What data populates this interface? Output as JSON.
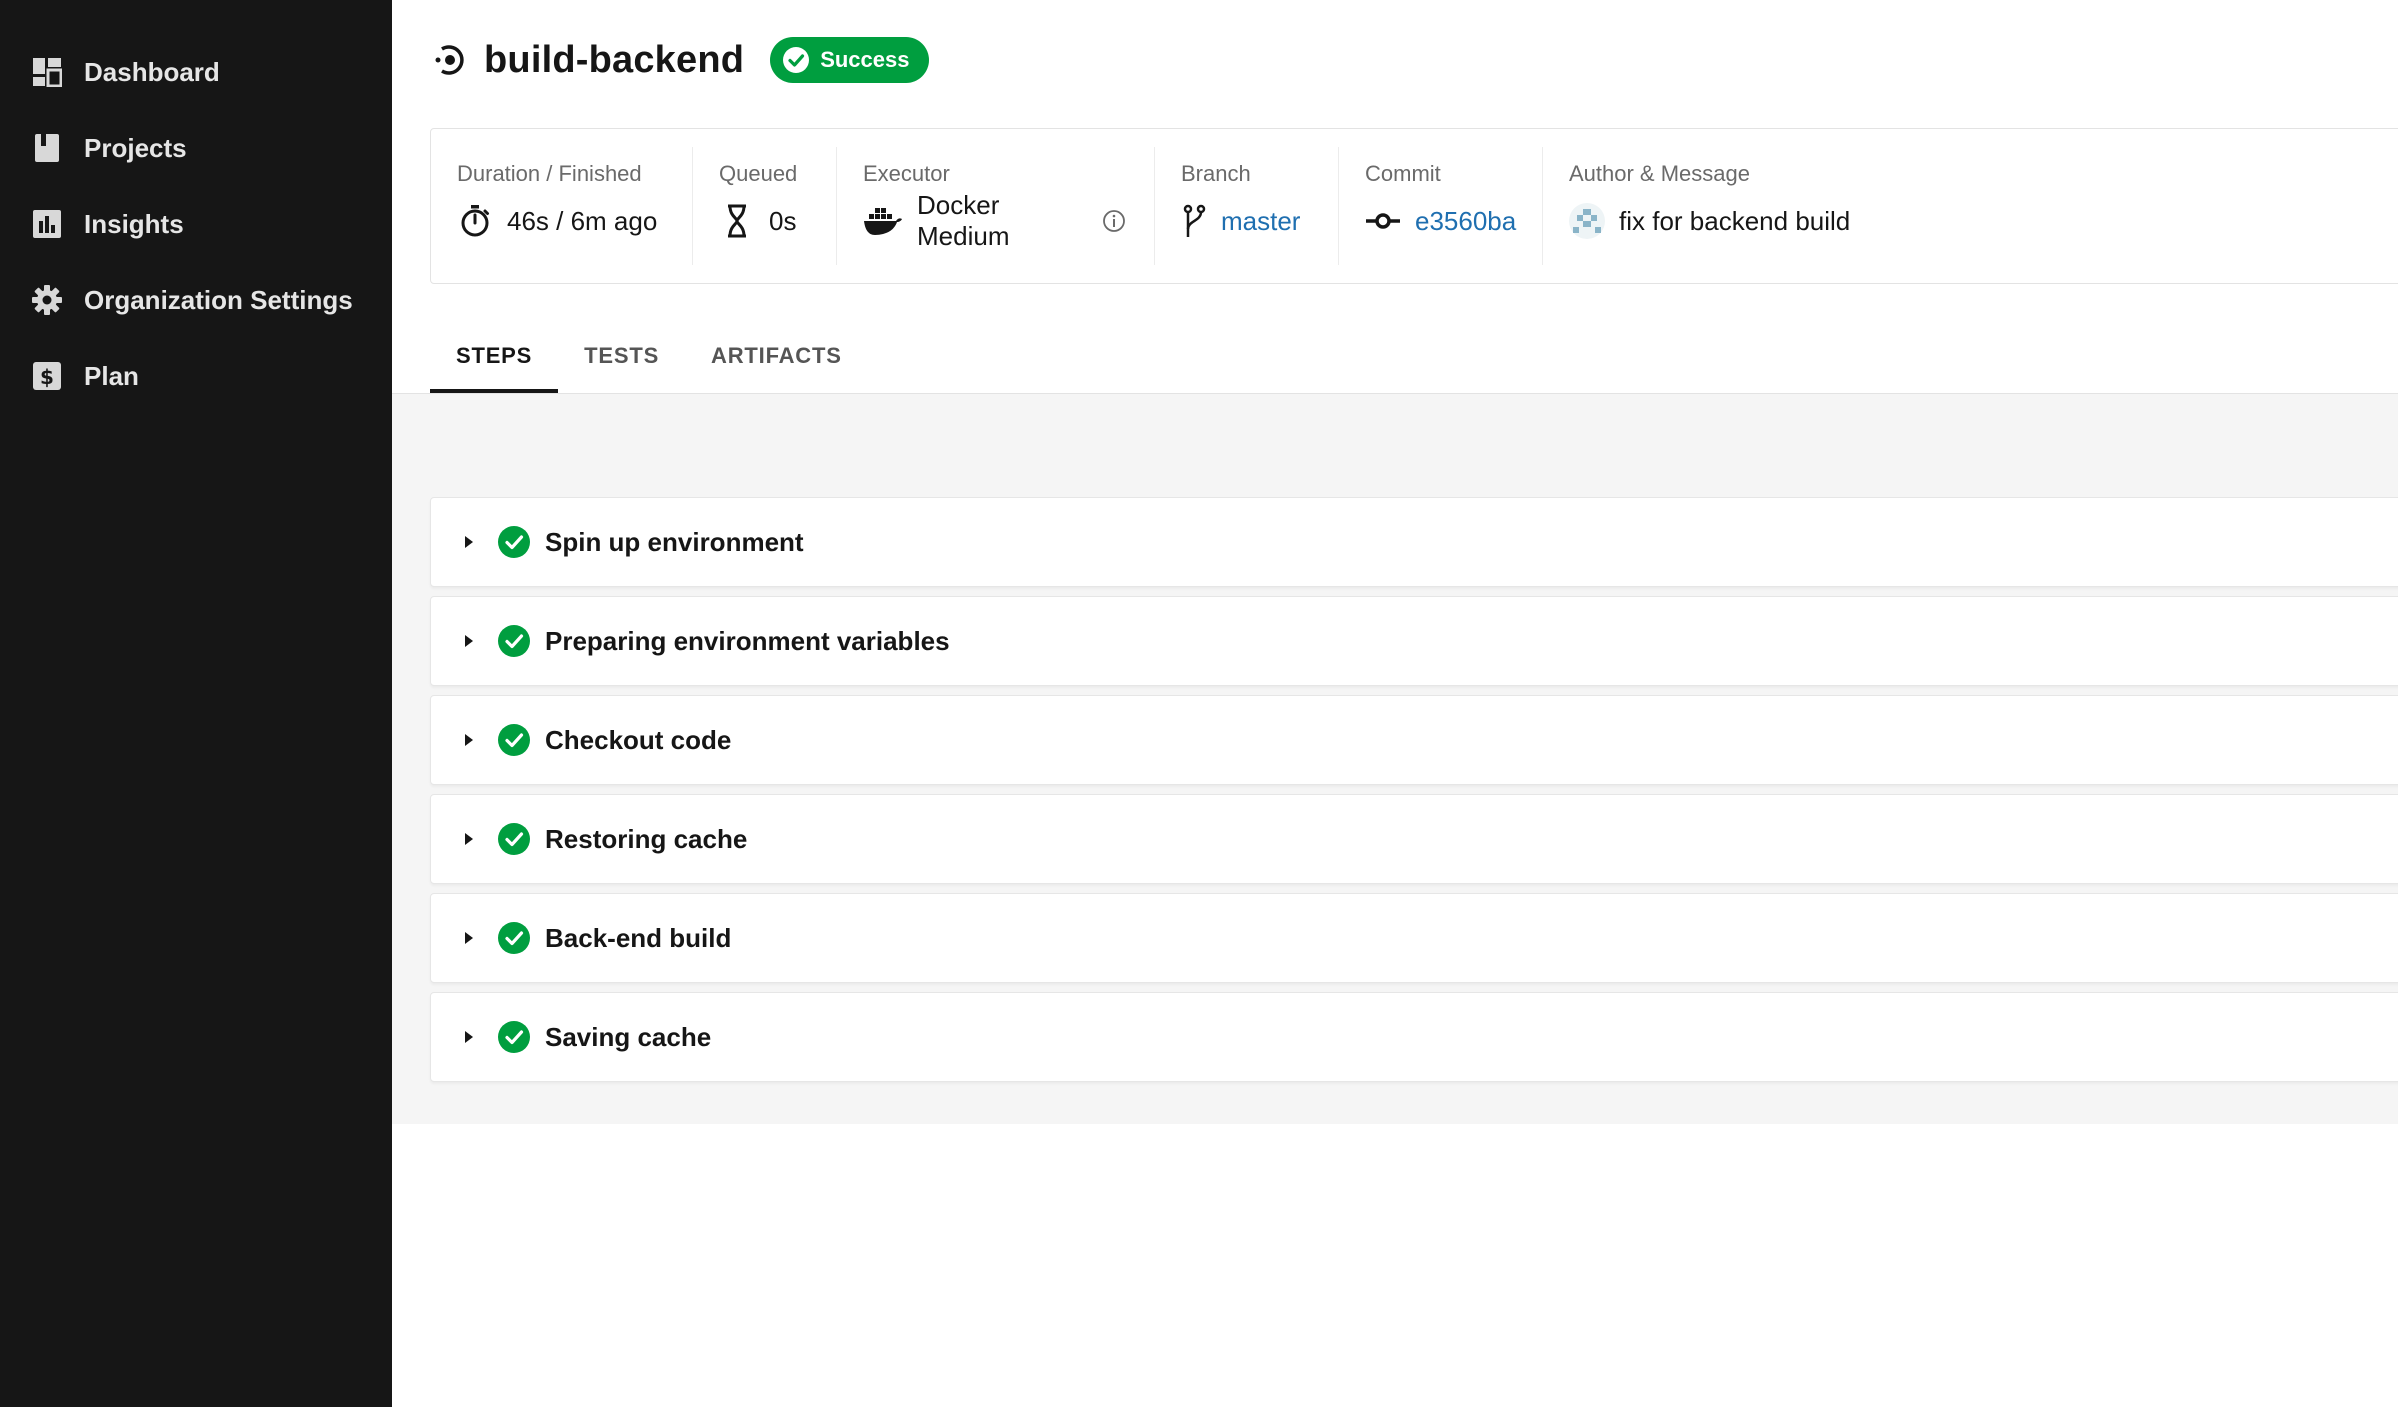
{
  "sidebar": {
    "items": [
      {
        "label": "Dashboard",
        "icon": "dashboard-icon"
      },
      {
        "label": "Projects",
        "icon": "book-icon"
      },
      {
        "label": "Insights",
        "icon": "bar-chart-icon"
      },
      {
        "label": "Organization Settings",
        "icon": "gear-icon"
      },
      {
        "label": "Plan",
        "icon": "dollar-icon"
      }
    ]
  },
  "header": {
    "title": "build-backend",
    "status": "Success",
    "status_color": "#009e3f"
  },
  "meta": {
    "duration": {
      "label": "Duration / Finished",
      "value": "46s / 6m ago"
    },
    "queued": {
      "label": "Queued",
      "value": "0s"
    },
    "executor": {
      "label": "Executor",
      "value": "Docker Medium"
    },
    "branch": {
      "label": "Branch",
      "value": "master"
    },
    "commit": {
      "label": "Commit",
      "value": "e3560ba"
    },
    "author": {
      "label": "Author & Message",
      "value": "fix for backend build"
    }
  },
  "tabs": [
    {
      "label": "STEPS",
      "active": true
    },
    {
      "label": "TESTS",
      "active": false
    },
    {
      "label": "ARTIFACTS",
      "active": false
    }
  ],
  "steps": [
    {
      "label": "Spin up environment"
    },
    {
      "label": "Preparing environment variables"
    },
    {
      "label": "Checkout code"
    },
    {
      "label": "Restoring cache"
    },
    {
      "label": "Back-end build"
    },
    {
      "label": "Saving cache"
    }
  ],
  "colors": {
    "sidebar_bg": "#161616",
    "success": "#009e3f",
    "link": "#1f6fb0"
  }
}
